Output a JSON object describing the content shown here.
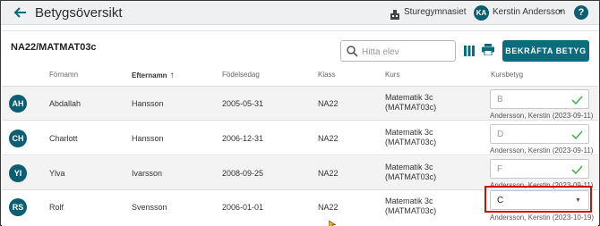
{
  "header": {
    "title": "Betygsöversikt",
    "school": "Sturegymnasiet",
    "user_initials": "KA",
    "user_name": "Kerstin Andersson",
    "help": "?"
  },
  "toolbar": {
    "course_title": "NA22/MATMAT03c",
    "search_placeholder": "Hitta elev",
    "confirm_label": "BEKRÄFTA BETYG"
  },
  "table": {
    "columns": [
      "Förnamn",
      "Efternamn",
      "Födelsedag",
      "Klass",
      "Kurs",
      "Kursbetyg"
    ],
    "rows": [
      {
        "initials": "AH",
        "first": "Abdallah",
        "last": "Hansson",
        "birth": "2005-05-31",
        "class": "NA22",
        "course_line1": "Matematik 3c",
        "course_line2": "(MATMAT03c)",
        "grade": "B",
        "graded_by": "Andersson, Kerstin (2023-09-11)",
        "status": "confirmed"
      },
      {
        "initials": "CH",
        "first": "Charlott",
        "last": "Hansson",
        "birth": "2006-12-31",
        "class": "NA22",
        "course_line1": "Matematik 3c",
        "course_line2": "(MATMAT03c)",
        "grade": "D",
        "graded_by": "Andersson, Kerstin (2023-09-11)",
        "status": "confirmed"
      },
      {
        "initials": "YI",
        "first": "Ylva",
        "last": "Ivarsson",
        "birth": "2008-09-25",
        "class": "NA22",
        "course_line1": "Matematik 3c",
        "course_line2": "(MATMAT03c)",
        "grade": "F",
        "graded_by": "Andersson, Kerstin (2023-09-11)",
        "status": "confirmed"
      },
      {
        "initials": "RS",
        "first": "Rolf",
        "last": "Svensson",
        "birth": "2006-01-01",
        "class": "NA22",
        "course_line1": "Matematik 3c",
        "course_line2": "(MATMAT03c)",
        "grade": "C",
        "graded_by": "Andersson, Kerstin (2023-10-19)",
        "status": "editable"
      }
    ]
  },
  "colors": {
    "brand": "#0d6b7e",
    "check": "#4caf50",
    "highlight": "#d40c0c"
  }
}
